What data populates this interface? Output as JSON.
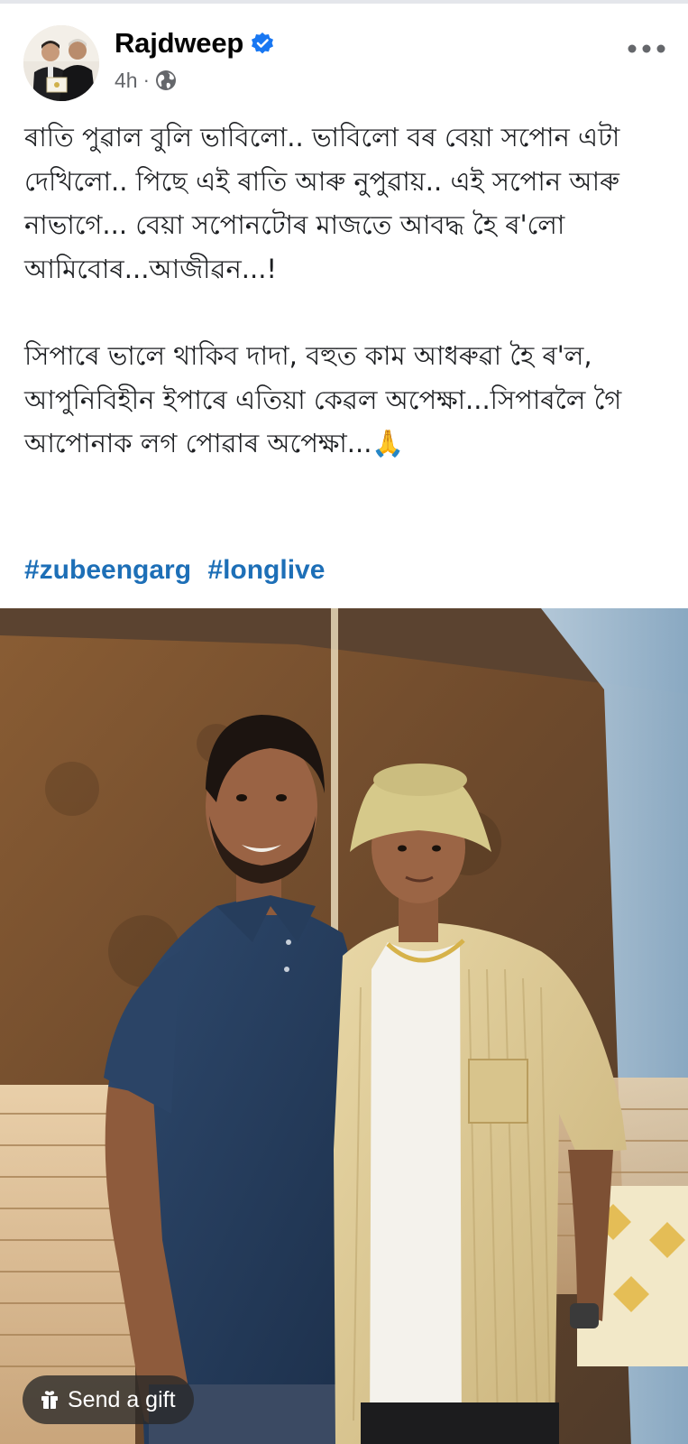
{
  "post": {
    "author": "Rajdweep",
    "time": "4h",
    "separator": "·",
    "paragraphs": [
      "ৰাতি পুৱাল বুলি ভাবিলো.. ভাবিলো বৰ বেয়া সপোন এটা দেখিলো.. পিছে এই ৰাতি আৰু নুপুৱায়.. এই সপোন আৰু নাভাগে... বেয়া সপোনটোৰ মাজতে আবদ্ধ হৈ ৰ'লো আমিবোৰ...আজীৱন...!",
      "সিপাৰে ভালে থাকিব দাদা, বহুত কাম আধৰুৱা হৈ ৰ'ল, আপুনিবিহীন ইপাৰে এতিয়া কেৱল অপেক্ষা...সিপাৰলৈ গৈ আপোনাক লগ পোৱাৰ অপেক্ষা...🙏"
    ],
    "hashtags": [
      "#zubeengarg",
      "#longlive"
    ]
  },
  "actions": {
    "more_label": "•••",
    "gift_label": "Send a gift"
  },
  "icons": {
    "verified": "verified-badge-icon",
    "audience": "globe-icon",
    "more": "more-options-icon",
    "gift": "gift-icon"
  },
  "colors": {
    "author": "#050505",
    "meta": "#65676b",
    "verified": "#1877f2",
    "hashtag": "#1d6fb7",
    "body_text": "#1c1e21"
  }
}
